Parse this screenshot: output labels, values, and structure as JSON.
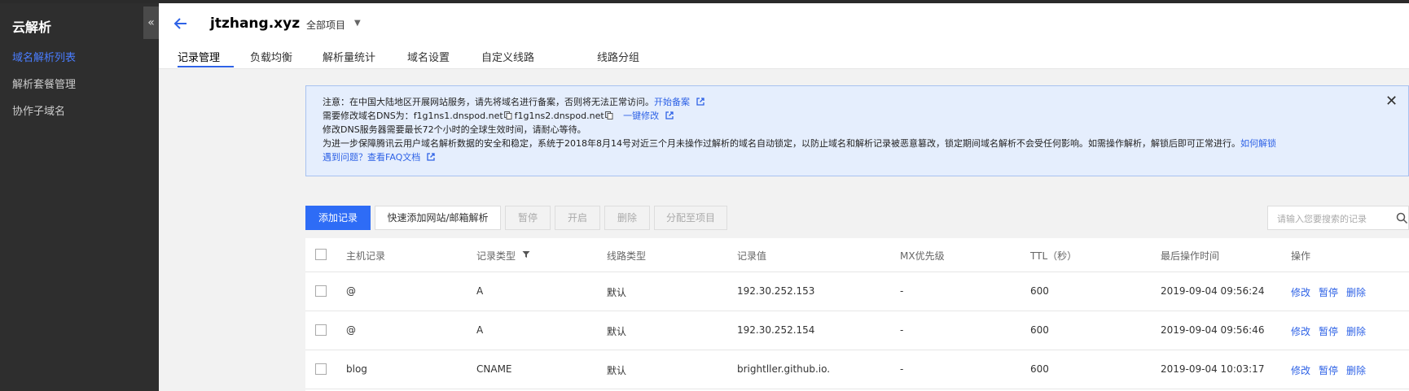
{
  "sidebar": {
    "title": "云解析",
    "collapse_label": "«",
    "items": [
      {
        "label": "域名解析列表",
        "active": true
      },
      {
        "label": "解析套餐管理",
        "active": false
      },
      {
        "label": "协作子域名",
        "active": false
      }
    ]
  },
  "header": {
    "domain": "jtzhang.xyz",
    "project_label": "全部项目",
    "tabs": [
      "记录管理",
      "负载均衡",
      "解析量统计",
      "域名设置",
      "自定义线路",
      "线路分组"
    ]
  },
  "notice": {
    "line1": "注意：在中国大陆地区开展网站服务，请先将域名进行备案，否则将无法正常访问。",
    "line1_link": "开始备案",
    "line2_prefix": "需要修改域名DNS为：",
    "dns1": "f1g1ns1.dnspod.net",
    "dns2": "f1g1ns2.dnspod.net",
    "line2_link": "一键修改",
    "line3": "修改DNS服务器需要最长72个小时的全球生效时间，请耐心等待。",
    "line4": "为进一步保障腾讯云用户域名解析数据的安全和稳定，系统于2018年8月14号对近三个月未操作过解析的域名自动锁定，以防止域名和解析记录被恶意篡改，锁定期间域名解析不会受任何影响。如需操作解析，解锁后即可正常进行。",
    "line4_link": "如何解锁",
    "line5_prefix": "遇到问题？",
    "line5_link": "查看FAQ文档",
    "close": "✕"
  },
  "toolbar": {
    "add": "添加记录",
    "quick_add": "快速添加网站/邮箱解析",
    "pause": "暂停",
    "enable": "开启",
    "delete": "删除",
    "assign": "分配至项目",
    "search_placeholder": "请输入您要搜索的记录"
  },
  "table": {
    "headers": [
      "主机记录",
      "记录类型",
      "线路类型",
      "记录值",
      "MX优先级",
      "TTL（秒）",
      "最后操作时间",
      "操作"
    ],
    "rows": [
      {
        "host": "@",
        "type": "A",
        "line": "默认",
        "value": "192.30.252.153",
        "mx": "-",
        "ttl": "600",
        "time": "2019-09-04 09:56:24"
      },
      {
        "host": "@",
        "type": "A",
        "line": "默认",
        "value": "192.30.252.154",
        "mx": "-",
        "ttl": "600",
        "time": "2019-09-04 09:56:46"
      },
      {
        "host": "blog",
        "type": "CNAME",
        "line": "默认",
        "value": "brightller.github.io.",
        "mx": "-",
        "ttl": "600",
        "time": "2019-09-04 10:03:17"
      }
    ],
    "actions": [
      "修改",
      "暂停",
      "删除"
    ]
  },
  "colors": {
    "accent": "#2e6cf6",
    "link": "#2e62e6",
    "sidebar_bg": "#2e2e2e",
    "notice_bg": "#e5eefd"
  }
}
